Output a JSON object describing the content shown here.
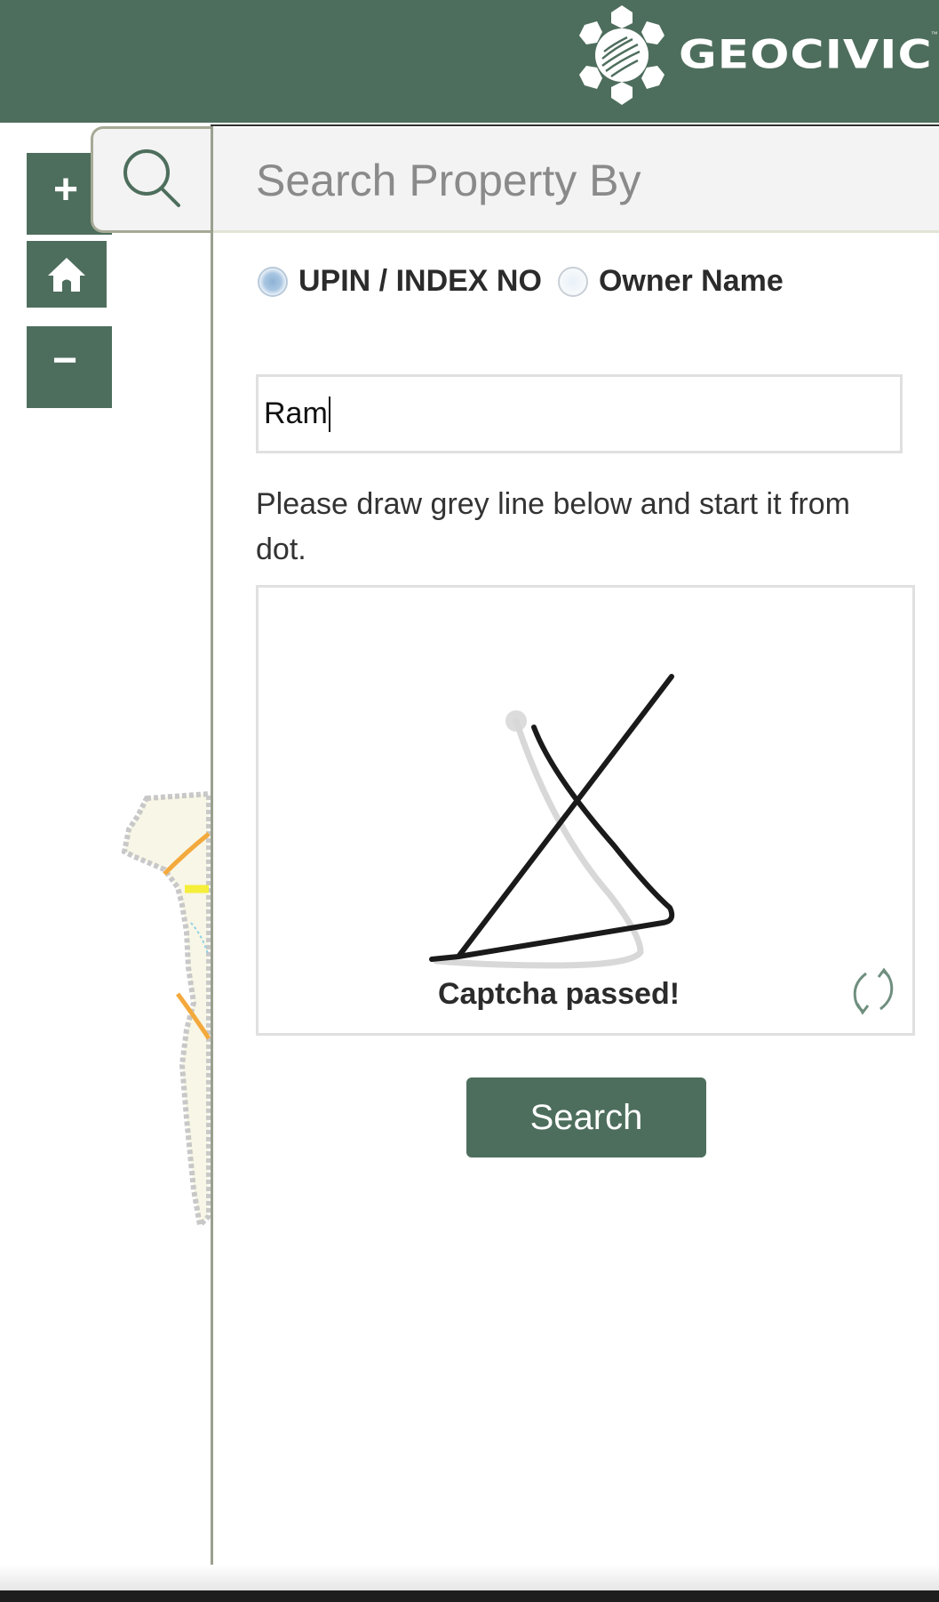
{
  "header": {
    "brand": "GEOCIVIC",
    "trademark": "™",
    "logo_icon": "geocivic-globe-gear-icon",
    "background_color": "#4e6e5d"
  },
  "map_controls": {
    "zoom_in": {
      "glyph": "+",
      "icon": "plus-icon"
    },
    "home": {
      "icon": "home-icon"
    },
    "zoom_out": {
      "glyph": "−",
      "icon": "minus-icon"
    },
    "search_toggle": {
      "icon": "search-icon"
    }
  },
  "search_panel": {
    "title": "Search Property By",
    "search_by_options": [
      {
        "label": "UPIN / INDEX NO",
        "selected": true
      },
      {
        "label": "Owner Name",
        "selected": false
      }
    ],
    "query_input": {
      "value": "Ram",
      "placeholder": ""
    },
    "captcha": {
      "instruction": "Please draw grey line below and start it from dot.",
      "status": "Captcha passed!",
      "refresh_icon": "refresh-icon"
    },
    "submit_label": "Search"
  },
  "colors": {
    "brand_green": "#4e6e5d",
    "panel_border": "#9aa08e"
  }
}
